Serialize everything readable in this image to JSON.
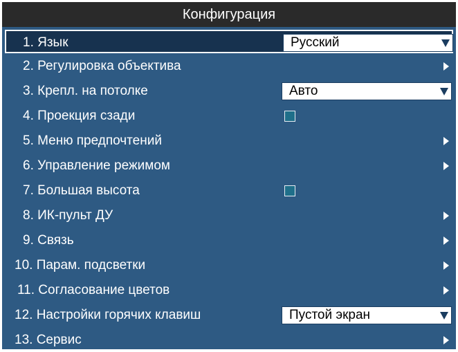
{
  "window": {
    "title": "Конфигурация"
  },
  "menu": {
    "items": [
      {
        "label": "1. Язык",
        "control": "dropdown",
        "value": "Русский",
        "selected": true
      },
      {
        "label": "2. Регулировка объектива",
        "control": "submenu-arrow"
      },
      {
        "label": "3. Крепл. на потолке",
        "control": "dropdown",
        "value": "Авто"
      },
      {
        "label": "4. Проекция сзади",
        "control": "checkbox",
        "checked": false
      },
      {
        "label": "5. Меню предпочтений",
        "control": "submenu-arrow"
      },
      {
        "label": "6. Управление режимом",
        "control": "submenu-arrow"
      },
      {
        "label": "7. Большая высота",
        "control": "checkbox",
        "checked": false
      },
      {
        "label": "8. ИК-пульт ДУ",
        "control": "submenu-arrow"
      },
      {
        "label": "9. Связь",
        "control": "submenu-arrow"
      },
      {
        "label": "10. Парам. подсветки",
        "control": "submenu-arrow"
      },
      {
        "label": "11. Согласование цветов",
        "control": "submenu-arrow"
      },
      {
        "label": "12. Настройки горячих клавиш",
        "control": "dropdown",
        "value": "Пустой экран"
      },
      {
        "label": "13. Сервис",
        "control": "submenu-arrow"
      }
    ]
  },
  "icons": {
    "dropdown": "triangle-down-icon",
    "submenu": "triangle-right-icon",
    "checkbox": "checkbox-icon"
  },
  "colors": {
    "panel": "#2e5a83",
    "title_bar": "#2a2a2a",
    "selected_row": "#17324f",
    "text": "#ffffff"
  }
}
